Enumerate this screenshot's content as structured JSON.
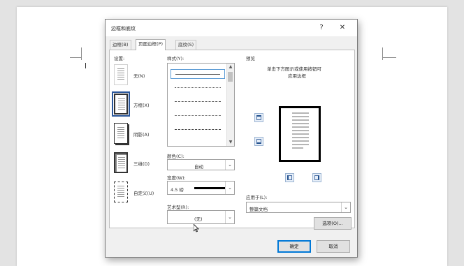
{
  "dialog": {
    "title": "边框和底纹",
    "help": "?",
    "close": "✕",
    "tabs": [
      {
        "label": "边框(B)"
      },
      {
        "label": "页面边框(P)"
      },
      {
        "label": "底纹(S)"
      }
    ]
  },
  "settings": {
    "heading": "设置:",
    "items": [
      {
        "label": "无(N)"
      },
      {
        "label": "方框(X)"
      },
      {
        "label": "阴影(A)"
      },
      {
        "label": "三维(D)"
      },
      {
        "label": "自定义(U)"
      }
    ],
    "selected": "方框(X)"
  },
  "style": {
    "heading": "样式(Y):"
  },
  "color": {
    "label": "颜色(C):",
    "value": "自动"
  },
  "width": {
    "label": "宽度(W):",
    "value": "4.5 磅"
  },
  "art": {
    "label": "艺术型(R):",
    "value": "(无)"
  },
  "preview": {
    "heading": "预览",
    "hint_line1": "单击下方图示或使用按钮可",
    "hint_line2": "应用边框"
  },
  "apply_to": {
    "label": "应用于(L):",
    "value": "整篇文档"
  },
  "buttons": {
    "options": "选项(O)...",
    "ok": "确定",
    "cancel": "取消"
  },
  "colors": {
    "accent": "#0078d7",
    "selected_blue": "#2b579a",
    "dialog_bg": "#f0f0f0"
  }
}
